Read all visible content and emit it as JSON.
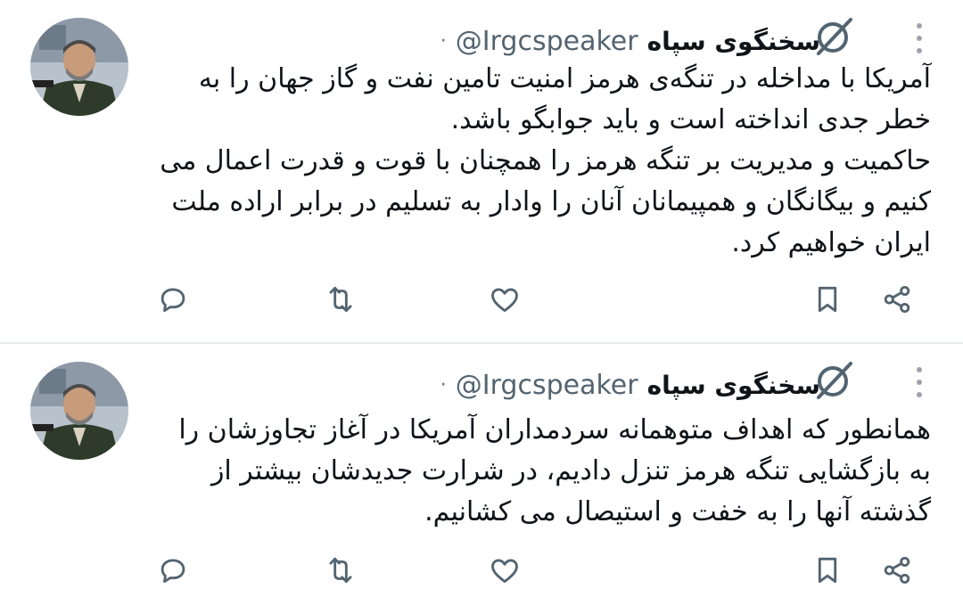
{
  "tweets": [
    {
      "author": {
        "name": "سخنگوی سپاه",
        "handle": "@Irgcspeaker"
      },
      "separator": "·",
      "paragraphs": [
        "آمریکا با مداخله در تنگه‌ی هرمز امنیت تامین نفت و گاز جهان را به خطر جدی انداخته است و باید جوابگو باشد.",
        "حاکمیت و مدیریت بر تنگه هرمز را همچنان با قوت و قدرت اعمال می کنیم و بیگانگان و همپیمانان آنان را وادار به تسلیم در برابر اراده ملت ایران خواهیم کرد."
      ],
      "actions": [
        "reply-icon",
        "retweet-icon",
        "like-icon",
        "bookmark-icon",
        "share-icon"
      ]
    },
    {
      "author": {
        "name": "سخنگوی سپاه",
        "handle": "@Irgcspeaker"
      },
      "separator": "·",
      "paragraphs": [
        "همانطور که اهداف متوهمانه سردمداران آمریکا در آغاز تجاوزشان را به بازگشایی تنگه هرمز تنزل دادیم، در شرارت جدیدشان بیشتر از گذشته آنها را به خفت و استیصال می کشانیم."
      ],
      "actions": [
        "reply-icon",
        "retweet-icon",
        "like-icon",
        "bookmark-icon",
        "share-icon"
      ]
    }
  ],
  "colors": {
    "text": "#0f1419",
    "secondary": "#536471",
    "icon": "#536471",
    "divider": "#e8ebee"
  }
}
